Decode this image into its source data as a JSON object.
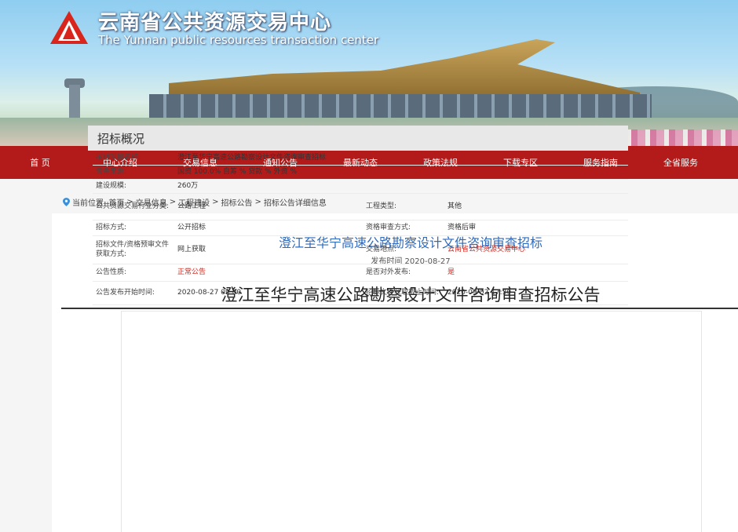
{
  "header": {
    "title": "云南省公共资源交易中心",
    "subtitle": "The Yunnan public resources transaction center"
  },
  "nav": [
    "首 页",
    "中心介绍",
    "交易信息",
    "通知公告",
    "最新动态",
    "政策法规",
    "下载专区",
    "服务指南",
    "全省服务"
  ],
  "breadcrumb": {
    "prefix": "当前位置:",
    "items": [
      "首页",
      "交易信息",
      "工程建设",
      "招标公告",
      "招标公告详细信息"
    ],
    "sep": ">"
  },
  "article": {
    "headline": "澄江至华宁高速公路勘察设计文件咨询审查招标",
    "publish_label": "发布时间",
    "publish_date": "2020-08-27",
    "title": "澄江至华宁高速公路勘察设计文件咨询审查招标公告"
  },
  "overview": {
    "heading": "招标概况",
    "rows": [
      {
        "label": "招标项目名称:",
        "value": "澄江至华宁高速公路勘察设计文件咨询审查招标"
      },
      {
        "label": "资金来源:",
        "value": "国资 100.0% 自筹 % 贷款 % 外资 %"
      },
      {
        "label": "建设规模:",
        "value": "260万"
      },
      {
        "label": "公共资源交易行业分类:",
        "value": "公路工程",
        "label2": "工程类型:",
        "value2": "其他"
      },
      {
        "label": "招标方式:",
        "value": "公开招标",
        "label2": "资格审查方式:",
        "value2": "资格后审"
      },
      {
        "label": "招标文件/资格预审文件获取方式:",
        "value": "网上获取",
        "label2": "交易地点:",
        "value2": "云南省公共资源交易中心"
      },
      {
        "label": "公告性质:",
        "value": "正常公告",
        "label2": "是否对外发布:",
        "value2": "是"
      },
      {
        "label": "公告发布开始时间:",
        "value": "2020-08-27 09:00",
        "label2": "招标文件获取截止时间:",
        "value2": "2020-09-02 17:30"
      }
    ]
  },
  "colors": {
    "nav_bg": "#b31b1b",
    "accent_blue": "#2f6bbd",
    "highlight_red": "#d2271e"
  }
}
